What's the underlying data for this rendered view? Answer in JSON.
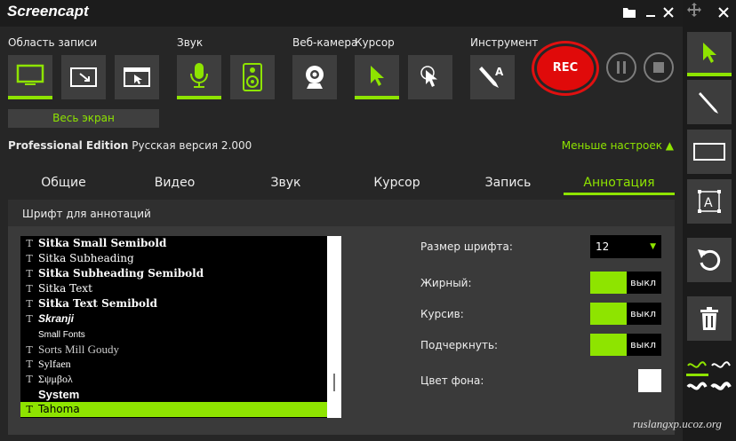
{
  "app": {
    "title": "Screencapt"
  },
  "groups": {
    "area": {
      "label": "Область записи",
      "fullscreen_label": "Весь экран"
    },
    "sound": {
      "label": "Звук"
    },
    "webcam": {
      "label": "Веб-камера"
    },
    "cursor": {
      "label": "Курсор"
    },
    "tool": {
      "label": "Инструмент"
    }
  },
  "rec": {
    "label": "REC"
  },
  "edition": {
    "name": "Professional Edition",
    "version": "Русская версия 2.000",
    "less_settings": "Меньше настроек ▲"
  },
  "tabs": [
    {
      "label": "Общие"
    },
    {
      "label": "Видео"
    },
    {
      "label": "Звук"
    },
    {
      "label": "Курсор"
    },
    {
      "label": "Запись"
    },
    {
      "label": "Аннотация"
    }
  ],
  "panel": {
    "title": "Шрифт для аннотаций"
  },
  "fonts": [
    {
      "name": "Sitka Small Semibold"
    },
    {
      "name": "Sitka Subheading"
    },
    {
      "name": "Sitka Subheading Semibold"
    },
    {
      "name": "Sitka Text"
    },
    {
      "name": "Sitka Text Semibold"
    },
    {
      "name": "Skranji"
    },
    {
      "name": "Small Fonts"
    },
    {
      "name": "Sorts Mill Goudy"
    },
    {
      "name": "Sylfaen"
    },
    {
      "name": "Σψμβολ"
    },
    {
      "name": "System"
    },
    {
      "name": "Tahoma"
    }
  ],
  "options": {
    "font_size_label": "Размер шрифта:",
    "font_size_value": "12",
    "bold_label": "Жирный:",
    "italic_label": "Курсив:",
    "underline_label": "Подчеркнуть:",
    "off_label": "выкл",
    "bg_color_label": "Цвет фона:",
    "bg_color": "#ffffff"
  },
  "colors": {
    "accent": "#8ee400",
    "rec": "#e00a0a"
  },
  "watermark": "ruslangxp.ucoz.org"
}
